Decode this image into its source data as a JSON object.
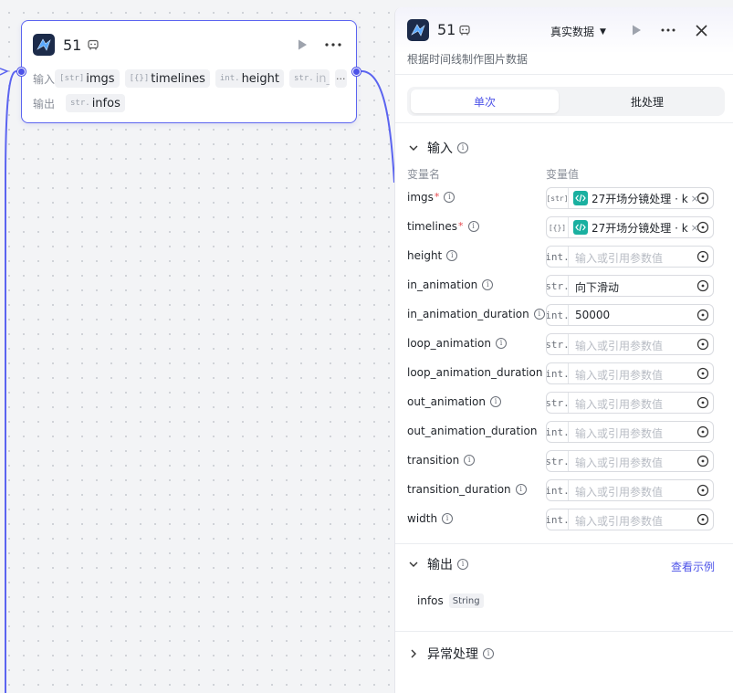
{
  "node": {
    "title": "51",
    "input_label": "输入",
    "output_label": "输出",
    "inputs": [
      {
        "type": "[str]",
        "name": "imgs"
      },
      {
        "type": "[{}]",
        "name": "timelines"
      },
      {
        "type": "int.",
        "name": "height"
      },
      {
        "type": "str.",
        "name": "in_an"
      }
    ],
    "more_label": "···",
    "outputs": [
      {
        "type": "str.",
        "name": "infos"
      }
    ]
  },
  "panel": {
    "title": "51",
    "data_mode": "真实数据",
    "description": "根据时间线制作图片数据",
    "tabs": {
      "single": "单次",
      "batch": "批处理"
    },
    "input_section": {
      "title": "输入",
      "col_name": "变量名",
      "col_value": "变量值",
      "params": [
        {
          "name": "imgs",
          "required": "*",
          "type": "[str]",
          "value": "27开场分镜处理 · k",
          "is_ref": true
        },
        {
          "name": "timelines",
          "required": "*",
          "type": "[{}]",
          "value": "27开场分镜处理 · k",
          "is_ref": true
        },
        {
          "name": "height",
          "required": "",
          "type": "int.",
          "value": "",
          "placeholder": "输入或引用参数值"
        },
        {
          "name": "in_animation",
          "required": "",
          "type": "str.",
          "value": "向下滑动",
          "placeholder": ""
        },
        {
          "name": "in_animation_duration",
          "required": "",
          "type": "int.",
          "value": "50000",
          "placeholder": ""
        },
        {
          "name": "loop_animation",
          "required": "",
          "type": "str.",
          "value": "",
          "placeholder": "输入或引用参数值"
        },
        {
          "name": "loop_animation_duration",
          "required": "",
          "type": "int.",
          "value": "",
          "placeholder": "输入或引用参数值"
        },
        {
          "name": "out_animation",
          "required": "",
          "type": "str.",
          "value": "",
          "placeholder": "输入或引用参数值"
        },
        {
          "name": "out_animation_duration",
          "required": "",
          "type": "int.",
          "value": "",
          "placeholder": "输入或引用参数值"
        },
        {
          "name": "transition",
          "required": "",
          "type": "str.",
          "value": "",
          "placeholder": "输入或引用参数值"
        },
        {
          "name": "transition_duration",
          "required": "",
          "type": "int.",
          "value": "",
          "placeholder": "输入或引用参数值"
        },
        {
          "name": "width",
          "required": "",
          "type": "int.",
          "value": "",
          "placeholder": "输入或引用参数值"
        }
      ]
    },
    "output_section": {
      "title": "输出",
      "example_link": "查看示例",
      "outputs": [
        {
          "name": "infos",
          "type": "String"
        }
      ]
    },
    "error_section": {
      "title": "异常处理"
    }
  },
  "colors": {
    "accent": "#4d53e8",
    "ref_icon": "#1ab0a0",
    "required": "#e5484d"
  },
  "icons": {
    "node_logo": "plugin-logo-icon",
    "run": "play-icon",
    "more": "more-icon",
    "close": "close-icon",
    "info": "info-icon",
    "variable": "variable-picker-icon",
    "ref": "code-ref-icon"
  }
}
